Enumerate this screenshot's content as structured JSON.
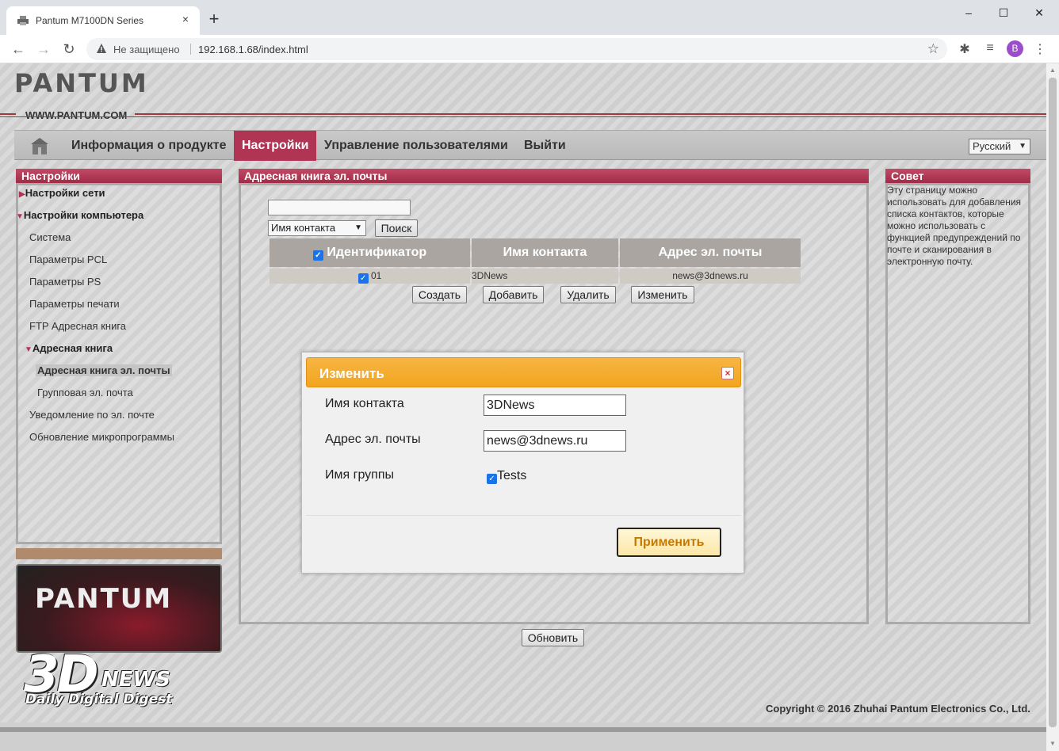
{
  "browser": {
    "tab_title": "Pantum M7100DN Series",
    "tab_close": "×",
    "new_tab": "+",
    "security_warning": "Не защищено",
    "url": "192.168.1.68/index.html",
    "avatar_letter": "B",
    "window_controls": [
      "–",
      "☐",
      "✕"
    ]
  },
  "header": {
    "logo": "PANTUM",
    "site": "WWW.PANTUM.COM"
  },
  "nav": {
    "items": [
      "Информация о продукте",
      "Настройки",
      "Управление пользователями",
      "Выйти"
    ],
    "active": "Настройки",
    "language": "Русский"
  },
  "sidebar": {
    "title": "Настройки",
    "items": [
      {
        "label": "Настройки сети",
        "marker": "▶"
      },
      {
        "label": "Настройки компьютера",
        "marker": "▼"
      },
      {
        "label": "Система"
      },
      {
        "label": "Параметры PCL"
      },
      {
        "label": "Параметры PS"
      },
      {
        "label": "Параметры печати"
      },
      {
        "label": "FTP Адресная книга"
      },
      {
        "label": "Адресная книга",
        "marker": "▼"
      },
      {
        "label": "Адресная книга эл. почты"
      },
      {
        "label": "Групповая эл. почта"
      },
      {
        "label": "Уведомление по эл. почте"
      },
      {
        "label": "Обновление микропрограммы"
      }
    ],
    "promo_logo": "PANTUM"
  },
  "main": {
    "title": "Адресная книга эл. почты",
    "search_value": "",
    "search_field": "Имя контакта",
    "search_button": "Поиск",
    "table": {
      "headers": [
        "Идентификатор",
        "Имя контакта",
        "Адрес эл. почты"
      ],
      "rows": [
        {
          "id": "01",
          "name": "3DNews",
          "email": "news@3dnews.ru",
          "checked": true
        }
      ]
    },
    "buttons": [
      "Создать",
      "Добавить",
      "Удалить",
      "Изменить"
    ],
    "refresh_button": "Обновить"
  },
  "tip": {
    "title": "Совет",
    "text": "Эту страницу можно использовать для добавления списка контактов, которые можно использовать с функцией предупреждений по почте и сканирования в электронную почту."
  },
  "footer": {
    "copyright": "Copyright © 2016 Zhuhai Pantum Electronics Co., Ltd."
  },
  "modal": {
    "title": "Изменить",
    "close": "×",
    "contact_label": "Имя контакта",
    "contact_value": "3DNews",
    "email_label": "Адрес эл. почты",
    "email_value": "news@3dnews.ru",
    "group_label": "Имя группы",
    "group_option": "Tests",
    "group_checked": true,
    "apply_button": "Применить"
  },
  "watermark": {
    "brand": "3D",
    "brand2": "NEWS",
    "tagline": "Daily Digital Digest"
  }
}
